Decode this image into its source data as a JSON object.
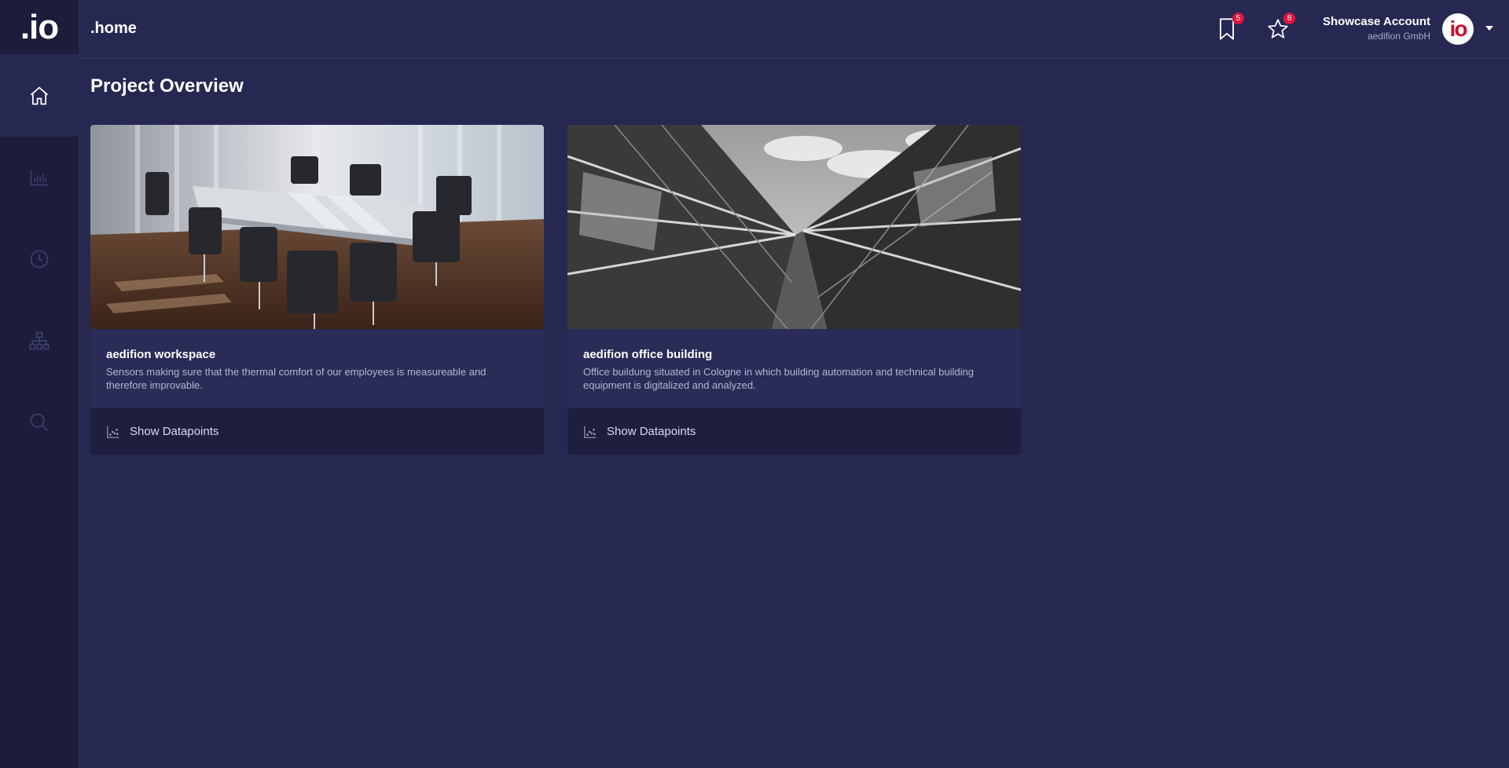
{
  "app": {
    "logo": ".io",
    "page_section": ".home"
  },
  "sidebar": {
    "items": [
      {
        "name": "home",
        "icon": "home-icon",
        "active": true
      },
      {
        "name": "analytics",
        "icon": "bar-chart-icon",
        "active": false
      },
      {
        "name": "history",
        "icon": "clock-icon",
        "active": false
      },
      {
        "name": "hierarchy",
        "icon": "sitemap-icon",
        "active": false
      },
      {
        "name": "search",
        "icon": "search-icon",
        "active": false
      }
    ]
  },
  "header": {
    "bookmarks_count": "5",
    "favorites_count": "8",
    "account_name": "Showcase Account",
    "account_org": "aedifion GmbH",
    "avatar_text": "io"
  },
  "main": {
    "title": "Project Overview",
    "projects": [
      {
        "title": "aedifion workspace",
        "description": "Sensors making sure that the thermal comfort of our employees is measureable and therefore improvable.",
        "action_label": "Show Datapoints"
      },
      {
        "title": "aedifion office building",
        "description": "Office buildung situated in Cologne in which building automation and technical building equipment is digitalized and analyzed.",
        "action_label": "Show Datapoints"
      }
    ]
  },
  "colors": {
    "background": "#272852",
    "sidebar": "#1c1c3b",
    "badge": "#e0143c",
    "brand_red": "#c8102e"
  }
}
